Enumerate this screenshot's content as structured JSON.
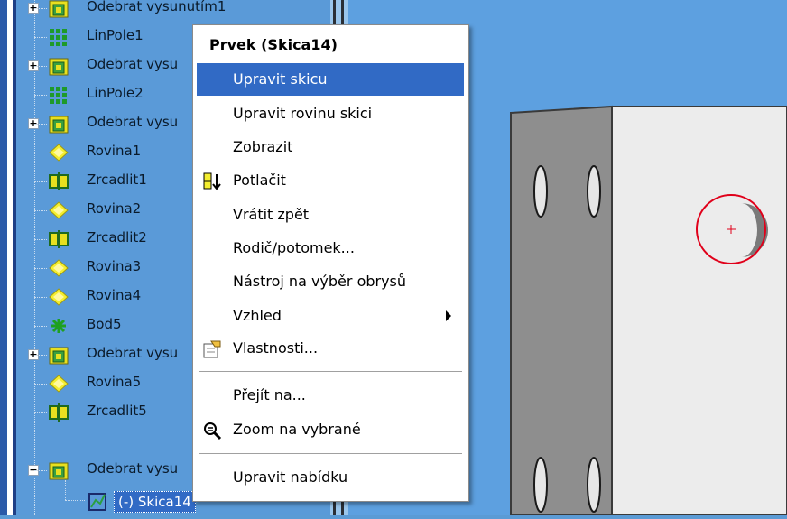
{
  "tree": {
    "items": [
      {
        "label": "Odebrat vysunutím1",
        "type": "cut",
        "expander": "+"
      },
      {
        "label": "LinPole1",
        "type": "pattern",
        "expander": ""
      },
      {
        "label": "Odebrat vysu",
        "type": "cut",
        "expander": "+"
      },
      {
        "label": "LinPole2",
        "type": "pattern",
        "expander": ""
      },
      {
        "label": "Odebrat vysu",
        "type": "cut",
        "expander": "+"
      },
      {
        "label": "Rovina1",
        "type": "plane",
        "expander": ""
      },
      {
        "label": "Zrcadlit1",
        "type": "mirror",
        "expander": ""
      },
      {
        "label": "Rovina2",
        "type": "plane",
        "expander": ""
      },
      {
        "label": "Zrcadlit2",
        "type": "mirror",
        "expander": ""
      },
      {
        "label": "Rovina3",
        "type": "plane",
        "expander": ""
      },
      {
        "label": "Rovina4",
        "type": "plane",
        "expander": ""
      },
      {
        "label": "Bod5",
        "type": "point",
        "expander": ""
      },
      {
        "label": "Odebrat vysu",
        "type": "cut",
        "expander": "+"
      },
      {
        "label": "Rovina5",
        "type": "plane",
        "expander": ""
      },
      {
        "label": "Zrcadlit5",
        "type": "mirror",
        "expander": ""
      },
      {
        "label": "Odebrat vysu",
        "type": "cut",
        "expander": "−"
      }
    ],
    "selected_child": {
      "label": "(-) Skica14",
      "type": "sketch"
    }
  },
  "context_menu": {
    "title": "Prvek (Skica14)",
    "items": [
      {
        "label": "Upravit skicu",
        "highlighted": true,
        "icon": ""
      },
      {
        "label": "Upravit rovinu skici",
        "icon": ""
      },
      {
        "label": "Zobrazit",
        "icon": ""
      },
      {
        "label": "Potlačit",
        "icon": "suppress-icon"
      },
      {
        "label": "Vrátit zpět",
        "icon": ""
      },
      {
        "label": "Rodič/potomek...",
        "icon": ""
      },
      {
        "label": "Nástroj na výběr obrysů",
        "icon": ""
      },
      {
        "label": "Vzhled",
        "icon": "",
        "submenu": true
      },
      {
        "label": "Vlastnosti...",
        "icon": "properties-icon"
      },
      {
        "label": "Přejít na...",
        "icon": ""
      },
      {
        "label": "Zoom na vybrané",
        "icon": "zoom-selected-icon"
      },
      {
        "label": "Upravit nabídku",
        "icon": ""
      }
    ]
  },
  "colors": {
    "tree_bg": "#5a9ad8",
    "highlight": "#316ac5",
    "sketch_circle": "#e0001a",
    "viewport_bg": "#5da0e0"
  }
}
